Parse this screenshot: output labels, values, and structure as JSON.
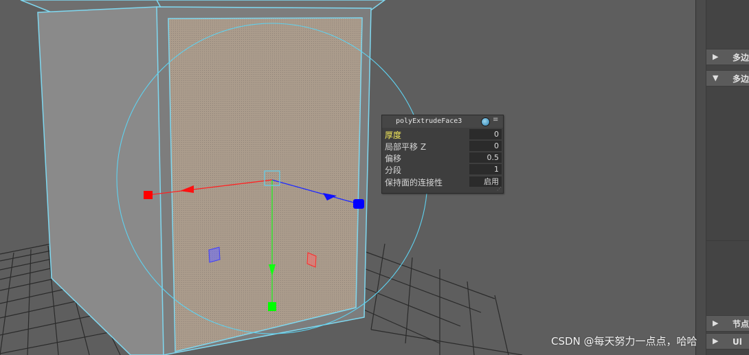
{
  "editor": {
    "title": "polyExtrudeFace3",
    "rows": [
      {
        "label": "厚度",
        "value": "0",
        "active": true
      },
      {
        "label": "局部平移 Z",
        "value": "0"
      },
      {
        "label": "偏移",
        "value": "0.5"
      },
      {
        "label": "分段",
        "value": "1"
      },
      {
        "label": "保持面的连接性",
        "value": "启用"
      }
    ]
  },
  "attribute_panel": {
    "sections": [
      {
        "label": "多边",
        "state": "collapsed"
      },
      {
        "label": "多边",
        "state": "expanded"
      },
      {
        "label": "节点",
        "state": "collapsed"
      },
      {
        "label": "Ul",
        "state": "collapsed"
      }
    ]
  },
  "watermark": "CSDN @每天努力一点点，哈哈",
  "colors": {
    "viewport_bg": "#5e5e5e",
    "selection_wire": "#7fd8f0",
    "face_selected": "#a89a8c",
    "axis_x": "#ff2020",
    "axis_y": "#22ee22",
    "axis_z": "#1a2aff",
    "field_active_label": "#f2e75a"
  },
  "icons": [
    "collapse-triangle-icon",
    "expand-triangle-icon",
    "manipulator-ball-icon",
    "menu-icon",
    "resize-grip-icon"
  ]
}
